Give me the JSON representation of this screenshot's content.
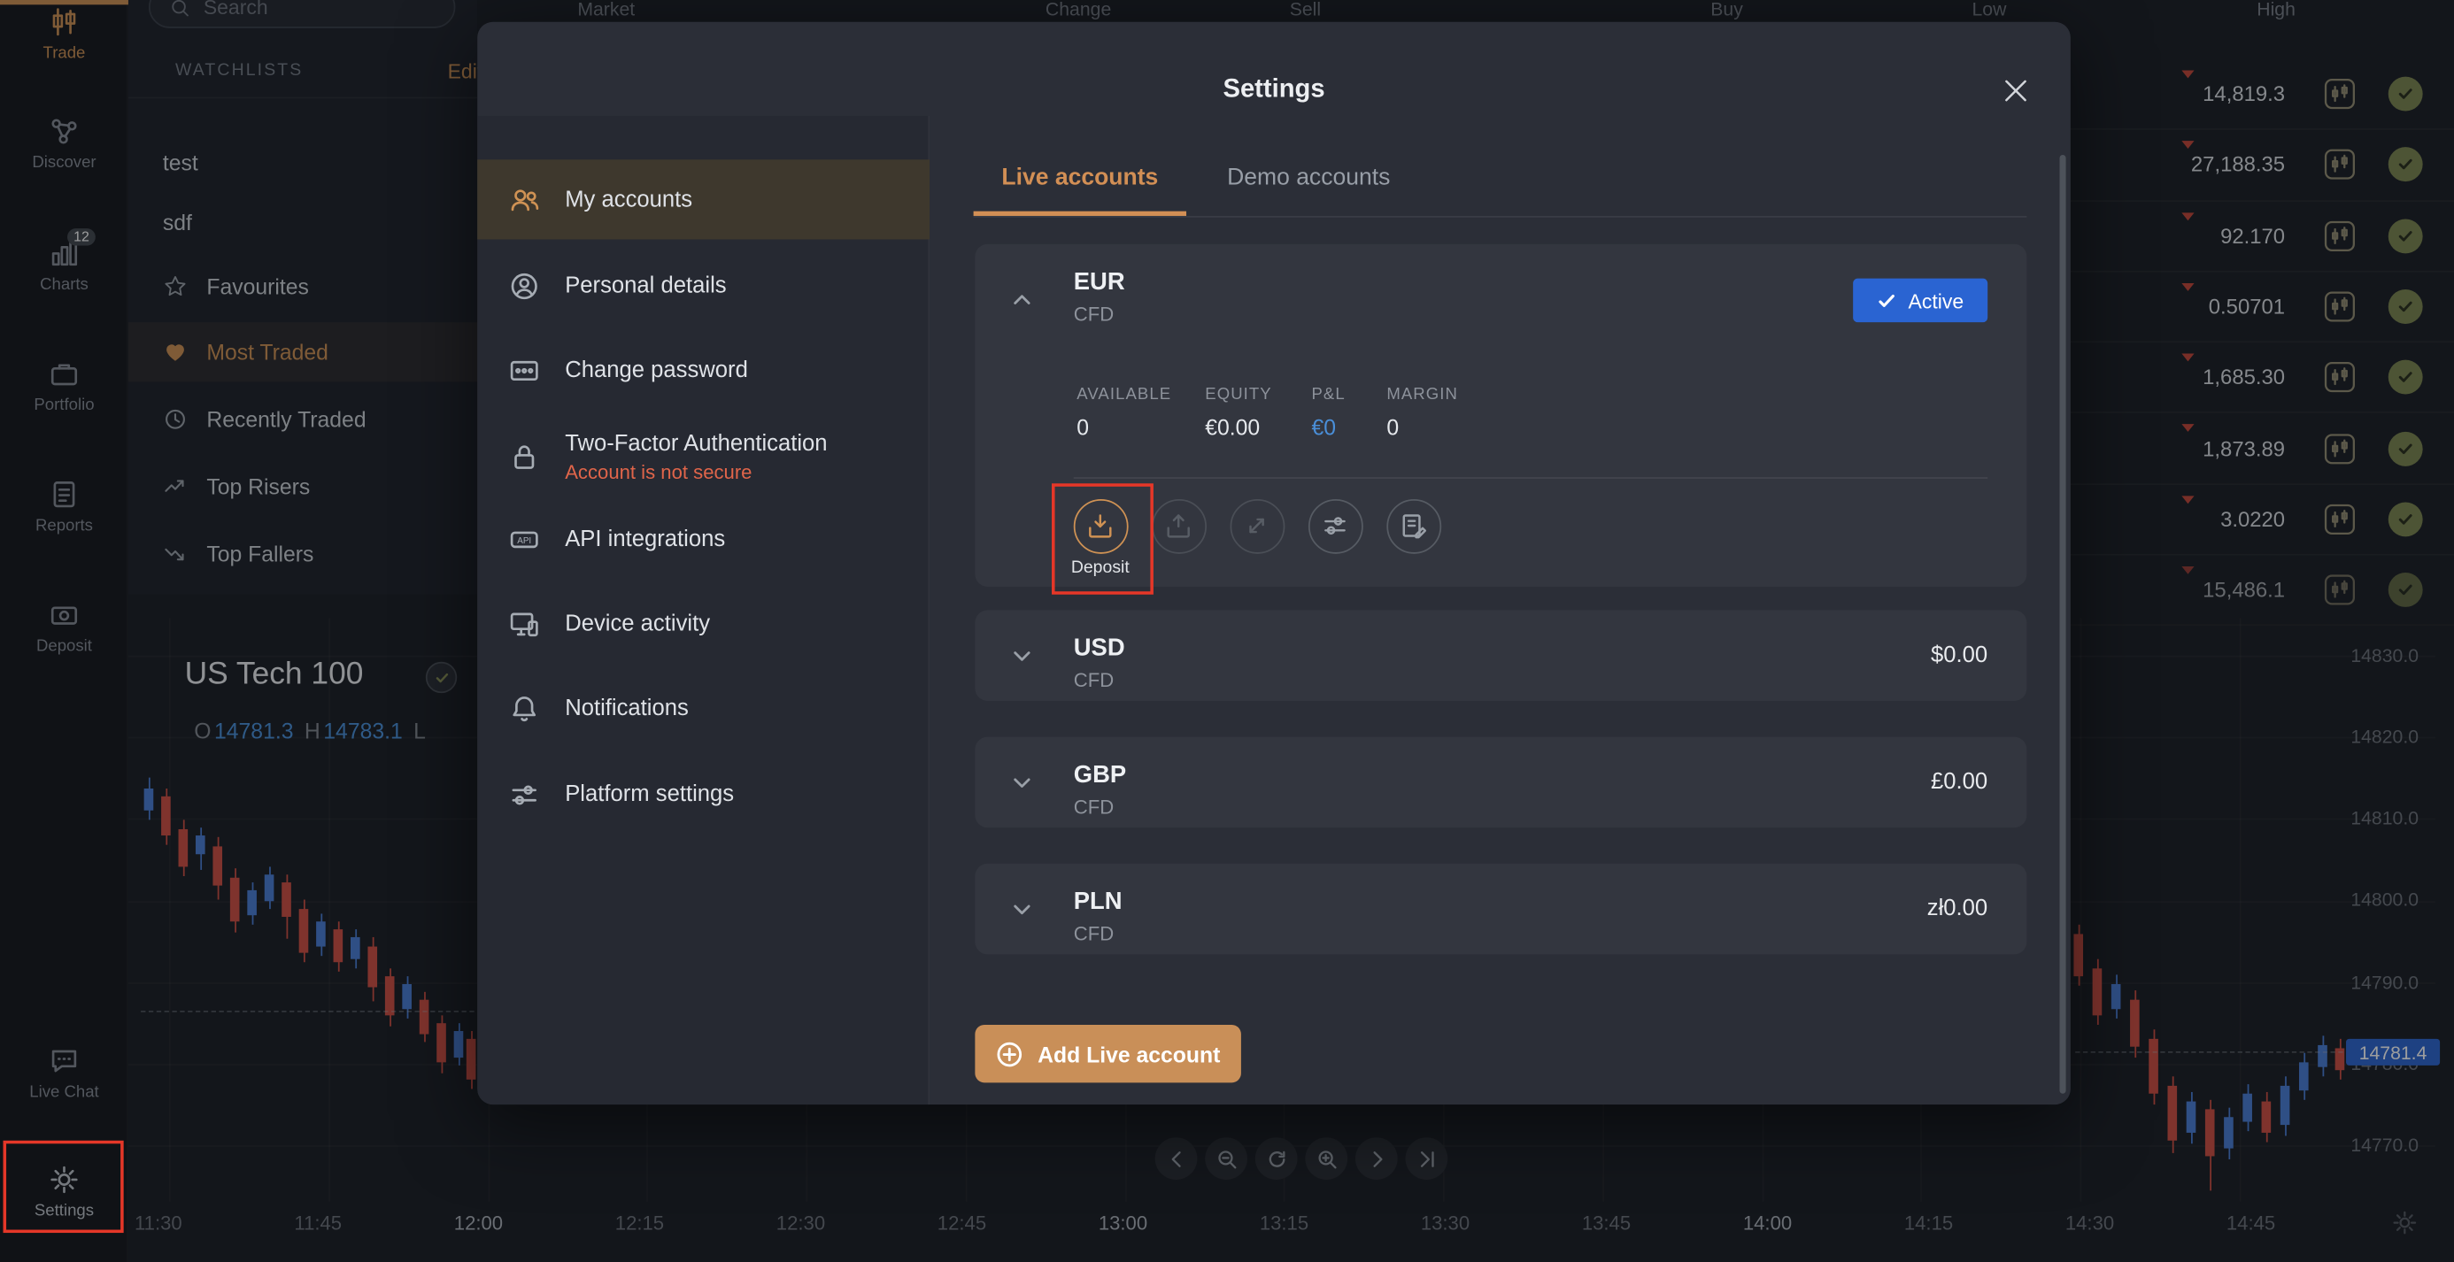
{
  "colors": {
    "accent_tan": "#cf9254",
    "accent_blue": "#2a64d2",
    "price_blue": "#4a8fd9",
    "alert_red": "#e53728",
    "candle_up": "#4a7dd6",
    "candle_down": "#cf4f43"
  },
  "topbar": {
    "search_placeholder": "Search",
    "columns": [
      "Market",
      "Change",
      "Sell",
      "Buy",
      "Low",
      "High"
    ]
  },
  "sidebar": {
    "items": [
      {
        "label": "Trade",
        "icon": "trade-icon"
      },
      {
        "label": "Discover",
        "icon": "discover-icon"
      },
      {
        "label": "Charts",
        "icon": "charts-icon",
        "badge": "12"
      },
      {
        "label": "Portfolio",
        "icon": "portfolio-icon"
      },
      {
        "label": "Reports",
        "icon": "reports-icon"
      },
      {
        "label": "Deposit",
        "icon": "deposit-icon"
      },
      {
        "label": "Live Chat",
        "icon": "live-chat-icon"
      },
      {
        "label": "Settings",
        "icon": "settings-gear-icon"
      }
    ]
  },
  "watchlists": {
    "header": "WATCHLISTS",
    "edit_label": "Edit",
    "items": [
      {
        "label": "test"
      },
      {
        "label": "sdf"
      },
      {
        "label": "Favourites",
        "icon": "star-icon"
      },
      {
        "label": "Most Traded",
        "icon": "heart-icon"
      },
      {
        "label": "Recently Traded",
        "icon": "clock-icon"
      },
      {
        "label": "Top Risers",
        "icon": "trend-up-icon"
      },
      {
        "label": "Top Fallers",
        "icon": "trend-down-icon"
      }
    ]
  },
  "symbol": {
    "title": "US Tech 100",
    "o_label": "O",
    "o_value": "14781.3",
    "h_label": "H",
    "h_value": "14783.1",
    "l_label": "L"
  },
  "quotes": {
    "rows": [
      {
        "value": "14,819.3"
      },
      {
        "value": "27,188.35"
      },
      {
        "value": "92.170"
      },
      {
        "value": "0.50701"
      },
      {
        "value": "1,685.30"
      },
      {
        "value": "1,873.89"
      },
      {
        "value": "3.0220"
      },
      {
        "value": "15,486.1"
      }
    ]
  },
  "chart": {
    "time_axis": [
      "11:30",
      "11:45",
      "12:00",
      "12:15",
      "12:30",
      "12:45",
      "13:00",
      "13:15",
      "13:30",
      "13:45",
      "14:00",
      "14:15",
      "14:30",
      "14:45"
    ],
    "price_axis": [
      "14830.0",
      "14820.0",
      "14810.0",
      "14800.0",
      "14790.0",
      "14780.0",
      "14770.0"
    ],
    "current_price": "14781.4",
    "candles_left": [
      [
        95,
        504,
        518,
        497,
        524,
        "u"
      ],
      [
        106,
        509,
        534,
        504,
        540,
        "d"
      ],
      [
        117,
        530,
        554,
        524,
        560,
        "d"
      ],
      [
        128,
        534,
        546,
        529,
        556,
        "u"
      ],
      [
        139,
        541,
        566,
        535,
        575,
        "d"
      ],
      [
        150,
        561,
        589,
        555,
        596,
        "d"
      ],
      [
        161,
        569,
        585,
        564,
        591,
        "u"
      ],
      [
        172,
        559,
        576,
        554,
        581,
        "u"
      ],
      [
        183,
        564,
        586,
        559,
        600,
        "d"
      ],
      [
        194,
        581,
        609,
        575,
        615,
        "d"
      ],
      [
        205,
        589,
        605,
        584,
        611,
        "u"
      ],
      [
        216,
        594,
        615,
        589,
        621,
        "d"
      ],
      [
        227,
        599,
        613,
        594,
        619,
        "u"
      ],
      [
        238,
        605,
        631,
        599,
        640,
        "d"
      ],
      [
        249,
        624,
        649,
        619,
        656,
        "d"
      ],
      [
        260,
        629,
        645,
        624,
        651,
        "u"
      ],
      [
        271,
        639,
        661,
        634,
        666,
        "d"
      ],
      [
        282,
        654,
        679,
        649,
        686,
        "d"
      ],
      [
        293,
        659,
        676,
        654,
        681,
        "u"
      ],
      [
        301,
        664,
        690,
        659,
        696,
        "d"
      ]
    ],
    "candles_right": [
      [
        1328,
        597,
        624,
        591,
        630,
        "d"
      ],
      [
        1340,
        619,
        649,
        613,
        655,
        "d"
      ],
      [
        1352,
        629,
        645,
        623,
        651,
        "u"
      ],
      [
        1364,
        639,
        669,
        633,
        676,
        "d"
      ],
      [
        1376,
        664,
        699,
        658,
        706,
        "d"
      ],
      [
        1388,
        694,
        729,
        688,
        737,
        "d"
      ],
      [
        1400,
        704,
        724,
        698,
        731,
        "u"
      ],
      [
        1412,
        709,
        739,
        703,
        761,
        "d"
      ],
      [
        1424,
        714,
        734,
        708,
        741,
        "u"
      ],
      [
        1436,
        699,
        717,
        693,
        723,
        "u"
      ],
      [
        1448,
        704,
        724,
        698,
        730,
        "d"
      ],
      [
        1460,
        694,
        719,
        688,
        726,
        "u"
      ],
      [
        1472,
        679,
        697,
        673,
        703,
        "u"
      ],
      [
        1484,
        668,
        682,
        662,
        688,
        "u"
      ],
      [
        1495,
        670,
        684,
        664,
        690,
        "d"
      ]
    ]
  },
  "modal": {
    "title": "Settings",
    "nav": [
      {
        "label": "My accounts",
        "icon": "users-icon"
      },
      {
        "label": "Personal details",
        "icon": "user-circle-icon"
      },
      {
        "label": "Change password",
        "icon": "password-card-icon"
      },
      {
        "label": "Two-Factor Authentication",
        "icon": "lock-icon",
        "sub": "Account is not secure"
      },
      {
        "label": "API integrations",
        "icon": "api-icon"
      },
      {
        "label": "Device activity",
        "icon": "devices-icon"
      },
      {
        "label": "Notifications",
        "icon": "bell-icon"
      },
      {
        "label": "Platform settings",
        "icon": "toggles-icon"
      }
    ],
    "tabs": [
      {
        "label": "Live accounts"
      },
      {
        "label": "Demo accounts"
      }
    ],
    "accounts": [
      {
        "code": "EUR",
        "type": "CFD",
        "status": "Active",
        "action_label": "Deposit",
        "stats": [
          {
            "label": "AVAILABLE",
            "value": "0"
          },
          {
            "label": "EQUITY",
            "value": "€0.00"
          },
          {
            "label": "P&L",
            "value": "€0"
          },
          {
            "label": "MARGIN",
            "value": "0"
          }
        ]
      },
      {
        "code": "USD",
        "type": "CFD",
        "balance": "$0.00"
      },
      {
        "code": "GBP",
        "type": "CFD",
        "balance": "£0.00"
      },
      {
        "code": "PLN",
        "type": "CFD",
        "balance": "zł0.00"
      }
    ],
    "add_account_label": "Add Live account"
  }
}
